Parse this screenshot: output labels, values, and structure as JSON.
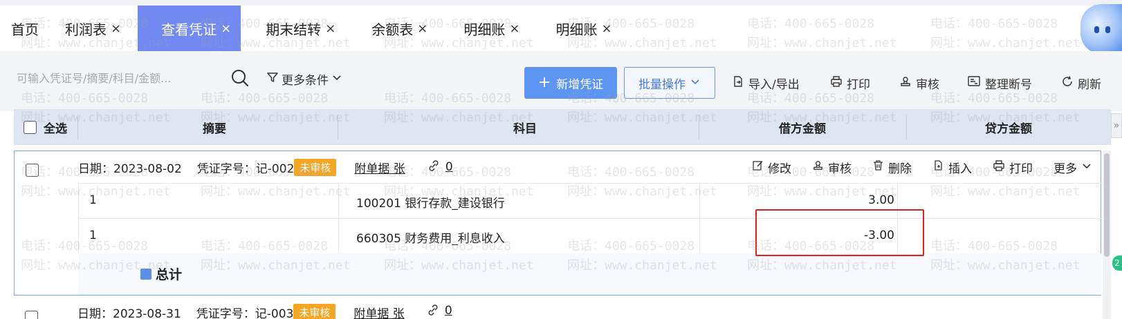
{
  "tabs": [
    {
      "label": "首页",
      "closable": false
    },
    {
      "label": "利润表",
      "closable": true
    },
    {
      "label": "查看凭证",
      "closable": true,
      "active": true
    },
    {
      "label": "期末结转",
      "closable": true
    },
    {
      "label": "余额表",
      "closable": true
    },
    {
      "label": "明细账",
      "closable": true
    },
    {
      "label": "明细账",
      "closable": true
    }
  ],
  "close_glyph": "×",
  "toolbar": {
    "search_placeholder": "可输入凭证号/摘要/科目/金额...",
    "more_conditions": "更多条件",
    "new_voucher": "新增凭证",
    "batch_ops": "批量操作",
    "import_export": "导入/导出",
    "print": "打印",
    "audit": "审核",
    "reorder": "整理断号",
    "refresh": "刷新"
  },
  "grid_header": {
    "select_all": "全选",
    "summary": "摘要",
    "account": "科目",
    "debit": "借方金额",
    "credit": "贷方金额"
  },
  "voucher": {
    "date_label": "日期：2023-08-02",
    "number_label": "凭证字号：记-002",
    "status": "未审核",
    "attachments": "附单据 张",
    "link_count": "0",
    "actions": {
      "edit": "修改",
      "audit": "审核",
      "delete": "删除",
      "insert": "插入",
      "print": "打印",
      "more": "更多"
    },
    "entries": [
      {
        "summary": "1",
        "account": "100201 银行存款_建设银行",
        "debit": "3.00",
        "credit": ""
      },
      {
        "summary": "1",
        "account": "660305 财务费用_利息收入",
        "debit": "-3.00",
        "credit": ""
      }
    ],
    "total_label": "总计"
  },
  "next_voucher": {
    "date_label": "日期：2023-08-31",
    "number_label": "凭证字号：记-003",
    "status": "未审核",
    "attachments": "附单据 张",
    "link_count": "0"
  },
  "side_badge": "2",
  "watermark": {
    "phone": "电话：400-665-0028",
    "site": "网址：www.chanjet.net"
  },
  "colors": {
    "active_tab": "#7189f0",
    "primary_button": "#5d95f2",
    "status_badge": "#f5a623",
    "highlight_box": "#e02020"
  }
}
